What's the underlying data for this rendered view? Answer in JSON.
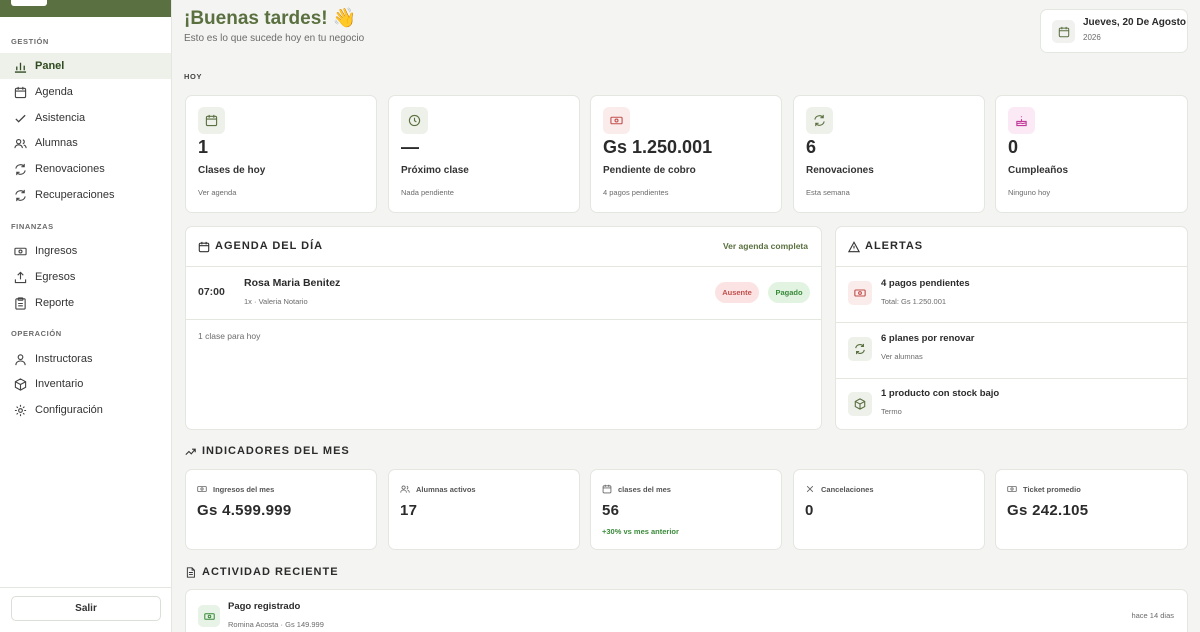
{
  "sidebar": {
    "sections": [
      {
        "title": "GESTIÓN",
        "items": [
          {
            "label": "Panel",
            "icon": "bar-chart-icon"
          },
          {
            "label": "Agenda",
            "icon": "calendar-icon"
          },
          {
            "label": "Asistencia",
            "icon": "check-icon"
          },
          {
            "label": "Alumnas",
            "icon": "users-icon"
          },
          {
            "label": "Renovaciones",
            "icon": "refresh-icon"
          },
          {
            "label": "Recuperaciones",
            "icon": "refresh-icon"
          }
        ]
      },
      {
        "title": "FINANZAS",
        "items": [
          {
            "label": "Ingresos",
            "icon": "banknote-icon"
          },
          {
            "label": "Egresos",
            "icon": "upload-icon"
          },
          {
            "label": "Reporte",
            "icon": "clipboard-icon"
          }
        ]
      },
      {
        "title": "OPERACIÓN",
        "items": [
          {
            "label": "Instructoras",
            "icon": "user-icon"
          },
          {
            "label": "Inventario",
            "icon": "box-icon"
          },
          {
            "label": "Configuración",
            "icon": "gear-icon"
          }
        ]
      }
    ],
    "active": "Panel",
    "logout_label": "Salir"
  },
  "header": {
    "greeting": "¡Buenas tardes! 👋",
    "subtitle": "Esto es lo que sucede hoy en tu negocio",
    "date_main": "Jueves, 20 De Agosto",
    "date_year": "2026"
  },
  "today": {
    "label": "HOY",
    "cards": [
      {
        "value": "1",
        "label": "Clases de hoy",
        "sub": "Ver agenda",
        "icon": "calendar-icon",
        "accent": "#5b7040",
        "bg": "#eef1ea"
      },
      {
        "value": "—",
        "label": "Próximo clase",
        "sub": "Nada pendiente",
        "icon": "clock-icon",
        "accent": "#5b7040",
        "bg": "#eef1ea"
      },
      {
        "value": "Gs 1.250.001",
        "label": "Pendiente de cobro",
        "sub": "4 pagos pendientes",
        "icon": "banknote-icon",
        "accent": "#c0504d",
        "bg": "#fbecec"
      },
      {
        "value": "6",
        "label": "Renovaciones",
        "sub": "Esta semana",
        "icon": "refresh-icon",
        "accent": "#5b7040",
        "bg": "#eef1ea"
      },
      {
        "value": "0",
        "label": "Cumpleaños",
        "sub": "Ninguno hoy",
        "icon": "cake-icon",
        "accent": "#c2399a",
        "bg": "#fbeaf5"
      }
    ]
  },
  "agenda": {
    "title": "AGENDA DEL DÍA",
    "link": "Ver agenda completa",
    "items": [
      {
        "time": "07:00",
        "name": "Rosa Maria Benitez",
        "detail": "1x · Valeria Notario",
        "status_attendance": "Ausente",
        "status_payment": "Pagado"
      }
    ],
    "footer": "1 clase para hoy"
  },
  "alerts": {
    "title": "ALERTAS",
    "items": [
      {
        "title": "4 pagos pendientes",
        "sub": "Total: Gs 1.250.001",
        "icon": "banknote-icon",
        "accent": "#c0504d",
        "bg": "#fbecec"
      },
      {
        "title": "6 planes por renovar",
        "sub": "Ver alumnas",
        "icon": "refresh-icon",
        "accent": "#5b7040",
        "bg": "#eef1ea"
      },
      {
        "title": "1 producto con stock bajo",
        "sub": "Termo",
        "icon": "box-icon",
        "accent": "#5b7040",
        "bg": "#eef1ea"
      }
    ]
  },
  "indicators": {
    "title": "INDICADORES DEL MES",
    "cards": [
      {
        "label": "Ingresos del mes",
        "value": "Gs 4.599.999",
        "note": "",
        "icon": "banknote-icon"
      },
      {
        "label": "Alumnas activos",
        "value": "17",
        "note": "",
        "icon": "users-icon"
      },
      {
        "label": "clases del mes",
        "value": "56",
        "note": "+30% vs mes anterior",
        "icon": "calendar-icon"
      },
      {
        "label": "Cancelaciones",
        "value": "0",
        "note": "",
        "icon": "x-icon"
      },
      {
        "label": "Ticket promedio",
        "value": "Gs 242.105",
        "note": "",
        "icon": "banknote-icon"
      }
    ]
  },
  "activity": {
    "title": "ACTIVIDAD RECIENTE",
    "items": [
      {
        "title": "Pago registrado",
        "sub": "Romina Acosta · Gs 149.999",
        "time": "hace 14 dias",
        "icon": "banknote-icon"
      }
    ]
  },
  "colors": {
    "brand": "#5b7040",
    "danger": "#c0504d",
    "success": "#3a8a3a"
  }
}
